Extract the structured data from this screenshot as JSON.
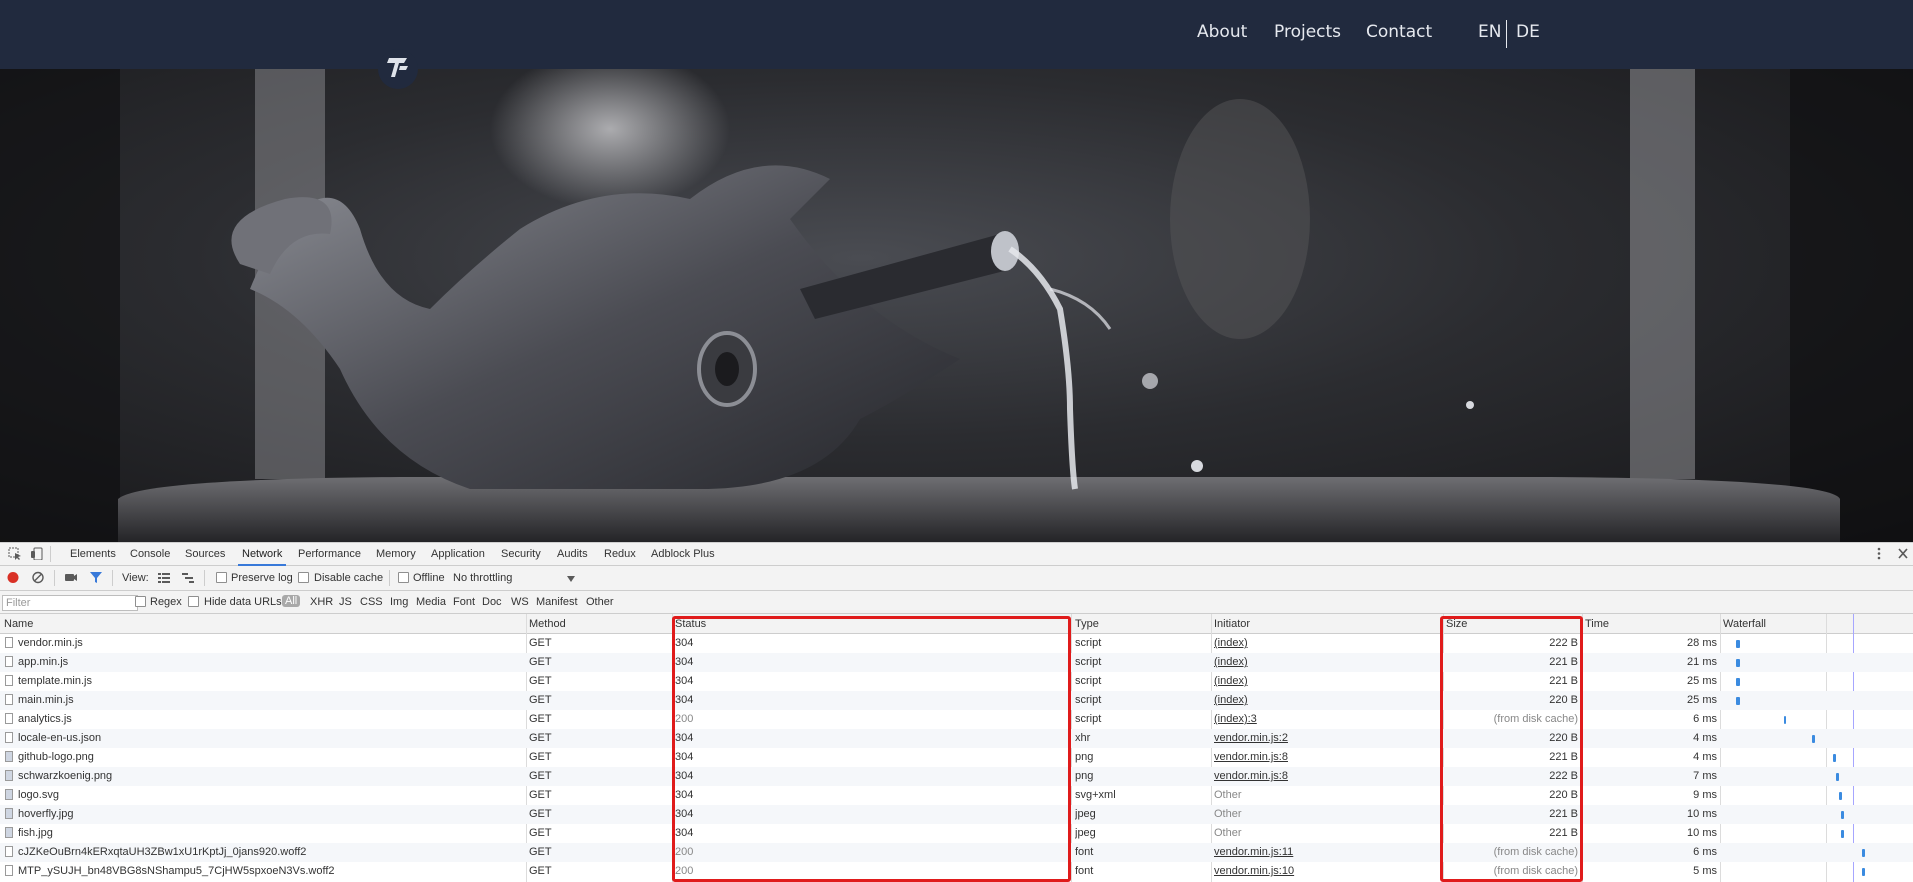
{
  "nav": {
    "links": [
      "About",
      "Projects",
      "Contact"
    ],
    "lang_en": "EN",
    "lang_de": "DE"
  },
  "devtools": {
    "tabs": [
      "Elements",
      "Console",
      "Sources",
      "Network",
      "Performance",
      "Memory",
      "Application",
      "Security",
      "Audits",
      "Redux",
      "Adblock Plus"
    ],
    "active_tab": "Network",
    "toolbar": {
      "view_label": "View:",
      "preserve_log": "Preserve log",
      "disable_cache": "Disable cache",
      "offline": "Offline",
      "throttling": "No throttling"
    },
    "filter": {
      "placeholder": "Filter",
      "regex": "Regex",
      "hide_data_urls": "Hide data URLs",
      "types": [
        "All",
        "XHR",
        "JS",
        "CSS",
        "Img",
        "Media",
        "Font",
        "Doc",
        "WS",
        "Manifest",
        "Other"
      ]
    },
    "columns": [
      "Name",
      "Method",
      "Status",
      "Type",
      "Initiator",
      "Size",
      "Time",
      "Waterfall"
    ],
    "rows": [
      {
        "name": "vendor.min.js",
        "method": "GET",
        "status": "304",
        "type": "script",
        "initiator": "(index)",
        "size": "222 B",
        "time": "28 ms"
      },
      {
        "name": "app.min.js",
        "method": "GET",
        "status": "304",
        "type": "script",
        "initiator": "(index)",
        "size": "221 B",
        "time": "21 ms"
      },
      {
        "name": "template.min.js",
        "method": "GET",
        "status": "304",
        "type": "script",
        "initiator": "(index)",
        "size": "221 B",
        "time": "25 ms"
      },
      {
        "name": "main.min.js",
        "method": "GET",
        "status": "304",
        "type": "script",
        "initiator": "(index)",
        "size": "220 B",
        "time": "25 ms"
      },
      {
        "name": "analytics.js",
        "method": "GET",
        "status": "200",
        "type": "script",
        "initiator": "(index):3",
        "size": "(from disk cache)",
        "time": "6 ms"
      },
      {
        "name": "locale-en-us.json",
        "method": "GET",
        "status": "304",
        "type": "xhr",
        "initiator": "vendor.min.js:2",
        "size": "220 B",
        "time": "4 ms"
      },
      {
        "name": "github-logo.png",
        "method": "GET",
        "status": "304",
        "type": "png",
        "initiator": "vendor.min.js:8",
        "size": "221 B",
        "time": "4 ms"
      },
      {
        "name": "schwarzkoenig.png",
        "method": "GET",
        "status": "304",
        "type": "png",
        "initiator": "vendor.min.js:8",
        "size": "222 B",
        "time": "7 ms"
      },
      {
        "name": "logo.svg",
        "method": "GET",
        "status": "304",
        "type": "svg+xml",
        "initiator": "Other",
        "size": "220 B",
        "time": "9 ms"
      },
      {
        "name": "hoverfly.jpg",
        "method": "GET",
        "status": "304",
        "type": "jpeg",
        "initiator": "Other",
        "size": "221 B",
        "time": "10 ms"
      },
      {
        "name": "fish.jpg",
        "method": "GET",
        "status": "304",
        "type": "jpeg",
        "initiator": "Other",
        "size": "221 B",
        "time": "10 ms"
      },
      {
        "name": "cJZKeOuBrn4kERxqtaUH3ZBw1xU1rKptJj_0jans920.woff2",
        "method": "GET",
        "status": "200",
        "type": "font",
        "initiator": "vendor.min.js:11",
        "size": "(from disk cache)",
        "time": "6 ms"
      },
      {
        "name": "MTP_ySUJH_bn48VBG8sNShampu5_7CjHW5spxoeN3Vs.woff2",
        "method": "GET",
        "status": "200",
        "type": "font",
        "initiator": "vendor.min.js:10",
        "size": "(from disk cache)",
        "time": "5 ms"
      }
    ]
  }
}
